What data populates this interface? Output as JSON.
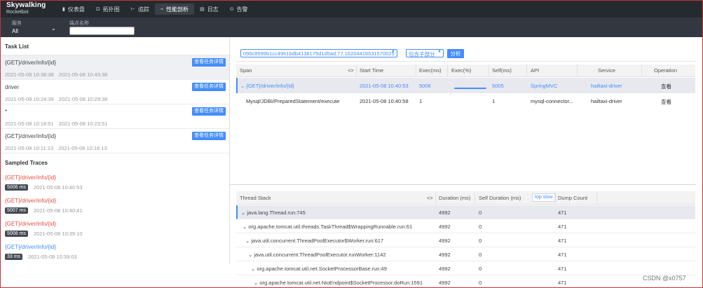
{
  "app": {
    "logo_top": "Skywalking",
    "logo_bottom": "Rocketbot"
  },
  "nav": [
    {
      "icon": "dashboard-icon",
      "glyph": "▮",
      "label": "仪表盘"
    },
    {
      "icon": "topology-icon",
      "glyph": "⊡",
      "label": "拓扑图"
    },
    {
      "icon": "trace-icon",
      "glyph": "⊢",
      "label": "追踪"
    },
    {
      "icon": "profile-icon",
      "glyph": "⌁",
      "label": "性能剖析",
      "active": true
    },
    {
      "icon": "log-icon",
      "glyph": "▤",
      "label": "日志"
    },
    {
      "icon": "alarm-icon",
      "glyph": "⊙",
      "label": "告警"
    }
  ],
  "filters": {
    "service_label": "服务",
    "service_value": "All",
    "endpoint_label": "端点名称",
    "endpoint_value": ""
  },
  "tasks": {
    "title": "Task List",
    "items": [
      {
        "name": "{GET}/driver/info/{id}",
        "start": "2021-05-08 10:38:38",
        "end": "2021-05-08 10:43:38",
        "button": "查看任务详情"
      },
      {
        "name": "driver",
        "start": "2021-05-08 10:24:38",
        "end": "2021-05-08 10:29:38",
        "button": "查看任务详情"
      },
      {
        "name": "*",
        "start": "2021-05-08 10:18:51",
        "end": "2021-05-08 10:23:51",
        "button": "查看任务详情"
      },
      {
        "name": "{GET}/driver/info/{id}",
        "start": "2021-05-08 10:11:13",
        "end": "2021-05-08 10:16:13",
        "button": "查看任务详情"
      }
    ]
  },
  "traces": {
    "title": "Sampled Traces",
    "items": [
      {
        "name": "{GET}/driver/info/{id}",
        "duration": "5006 ms",
        "time": "2021-05-08 10:40:53",
        "status": "error"
      },
      {
        "name": "{GET}/driver/info/{id}",
        "duration": "5007 ms",
        "time": "2021-05-08 10:40:41",
        "status": "error"
      },
      {
        "name": "{GET}/driver/info/{id}",
        "duration": "5008 ms",
        "time": "2021-05-08 10:39:10",
        "status": "error"
      },
      {
        "name": "{GET}/driver/info/{id}",
        "duration": "33 ms",
        "time": "2021-05-08 10:39:03",
        "status": "ok"
      }
    ]
  },
  "analysis": {
    "segment_id": "096c8599b1cc4961bdb4138175d1d5ad.77.16204416531570025",
    "mode": "包含子部分",
    "analyze_button": "分析"
  },
  "span_table": {
    "headers": [
      "Span",
      "<>",
      "Start Time",
      "Exec(ms)",
      "Exec(%)",
      "Self(ms)",
      "API",
      "Service",
      "Operation"
    ],
    "rows": [
      {
        "span": "{GET}/driver/info/{id}",
        "start": "2021-05-08 10:40:53",
        "exec": "5006",
        "exec_pct": 1.0,
        "self": "5005",
        "api": "SpringMVC",
        "service": "hailtaxi-driver",
        "op": "查看"
      },
      {
        "span": "Mysql/JDBI/PreparedStatement/execute",
        "start": "2021-05-08 10:40:58",
        "exec": "1",
        "exec_pct": 0.0,
        "self": "1",
        "api": "mysql-connector...",
        "service": "hailtaxi-driver",
        "op": "查看"
      }
    ]
  },
  "thread_stack": {
    "headers": [
      "Thread Stack",
      "<>",
      "Duration (ms)",
      "Self Duration (ms)",
      "top slow",
      "Dump Count"
    ],
    "rows": [
      {
        "frame": "java.lang.Thread.run:745",
        "duration": "4992",
        "self": "0",
        "dump": "471"
      },
      {
        "frame": "org.apache.tomcat.util.threads.TaskThread$WrappingRunnable.run:61",
        "duration": "4992",
        "self": "0",
        "dump": "471"
      },
      {
        "frame": "java.util.concurrent.ThreadPoolExecutor$Worker.run:617",
        "duration": "4992",
        "self": "0",
        "dump": "471"
      },
      {
        "frame": "java.util.concurrent.ThreadPoolExecutor.runWorker:1142",
        "duration": "4992",
        "self": "0",
        "dump": "471"
      },
      {
        "frame": "org.apache.tomcat.util.net.SocketProcessorBase.run:49",
        "duration": "4992",
        "self": "0",
        "dump": "471"
      },
      {
        "frame": "org.apache.tomcat.util.net.NioEndpoint$SocketProcessor.doRun:1591",
        "duration": "4992",
        "self": "0",
        "dump": "471"
      }
    ]
  },
  "watermark": "CSDN @x0757",
  "colors": {
    "accent": "#448dfe",
    "error": "#e54c42",
    "nav_bg": "#252a2f"
  }
}
